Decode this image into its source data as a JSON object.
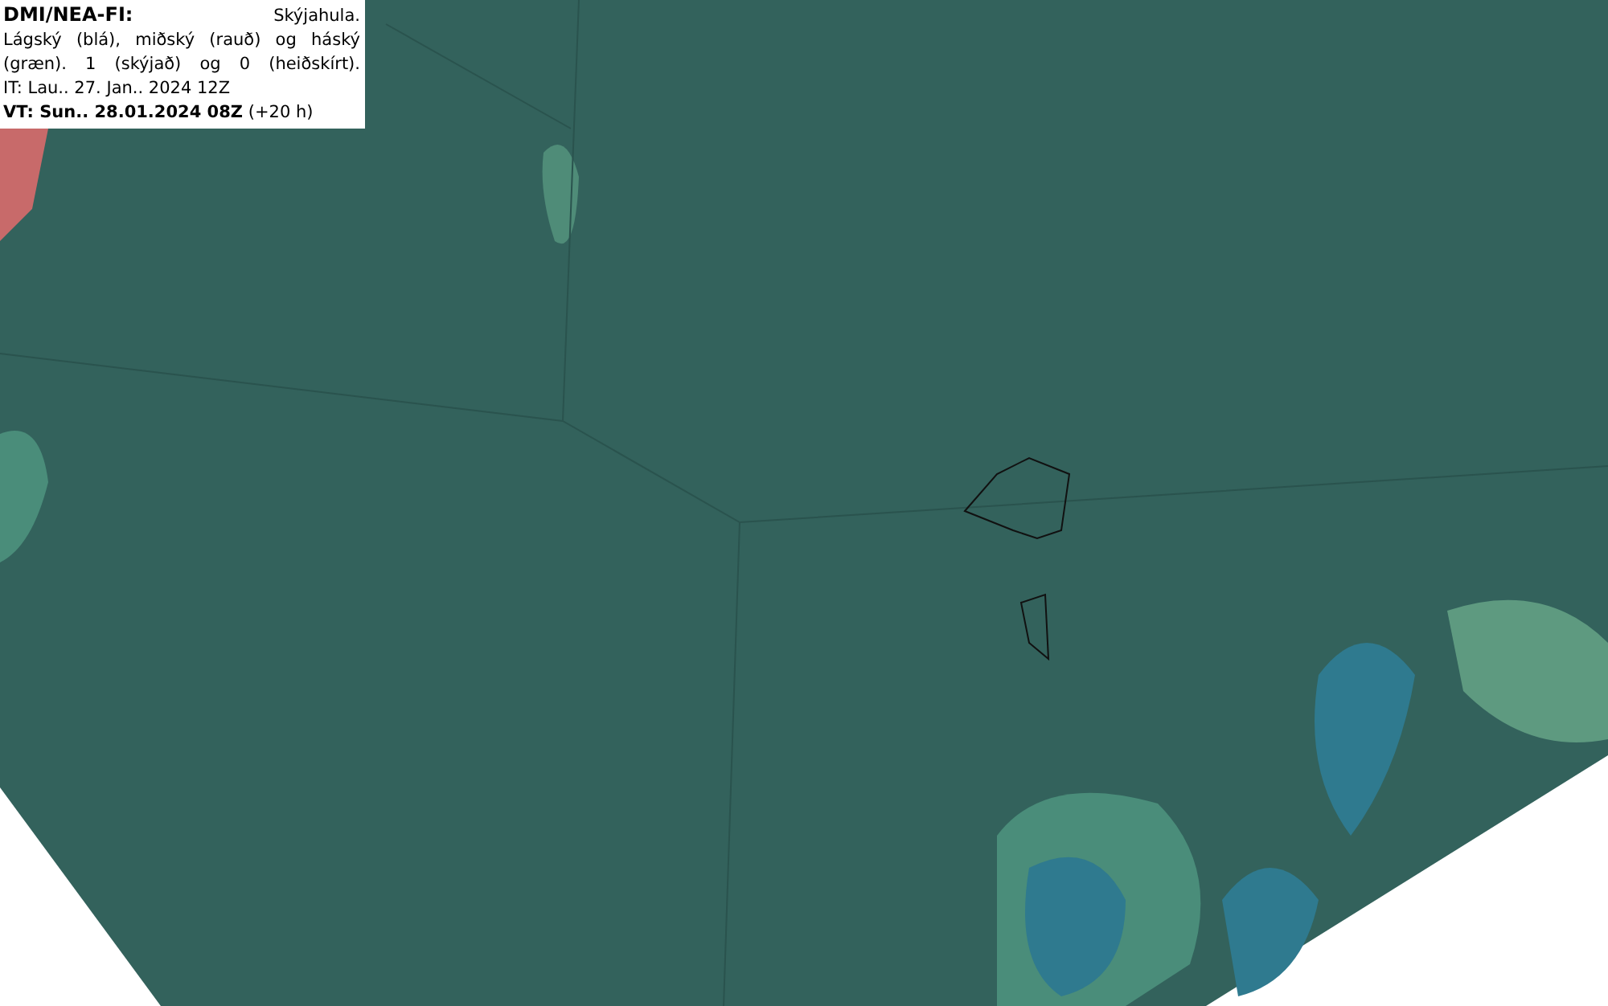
{
  "legend": {
    "source": "DMI/NEA-FI:",
    "title": "Skýjahula.",
    "description": "Lágský (blá), miðský (rauð) og háský (græn). 1 (skýjað) og 0 (heiðskírt).",
    "issue_time": "IT: Lau.. 27. Jan.. 2024 12Z",
    "valid_time": "**VT: Sun.. 28.01.2024 08Z** (+20 h)"
  }
}
